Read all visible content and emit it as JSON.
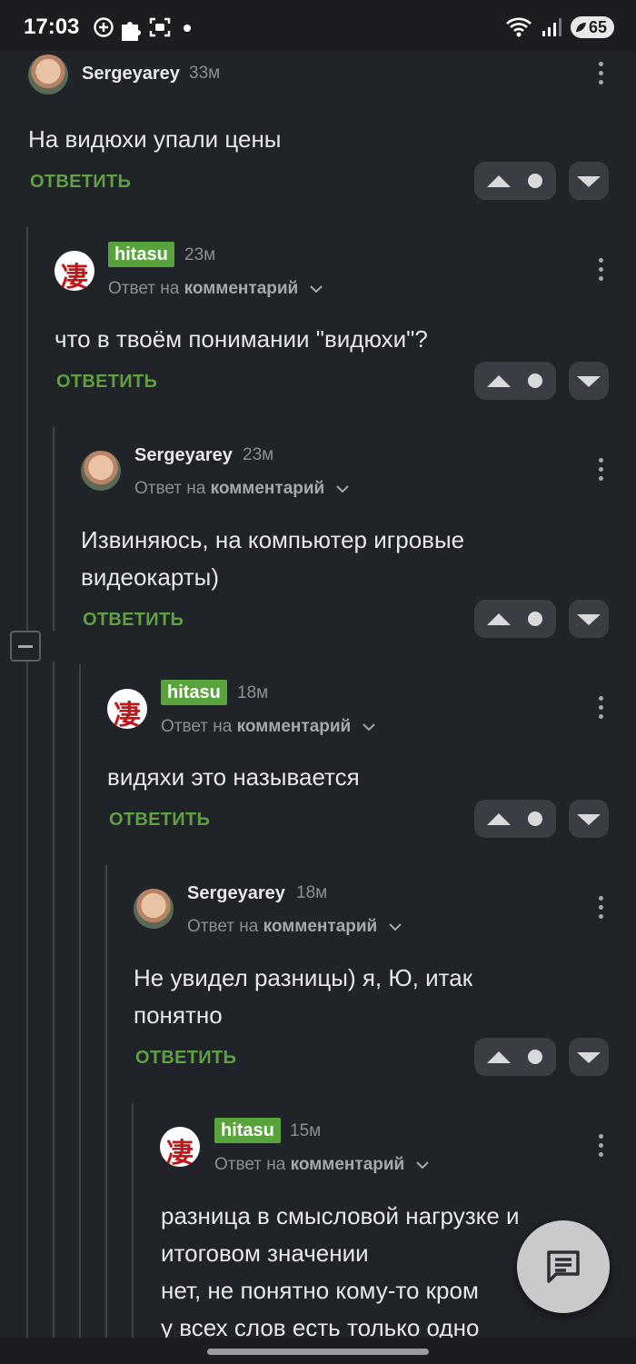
{
  "status_bar": {
    "time": "17:03",
    "battery": "65",
    "icons": [
      "add-circle-icon",
      "puzzle-icon",
      "scan-icon",
      "dot-icon",
      "wifi-icon",
      "signal-icon",
      "battery-icon"
    ]
  },
  "labels": {
    "reply_to_prefix": "Ответ на",
    "reply_to_target": "комментарий",
    "answer_button": "ОТВЕТИТЬ"
  },
  "comments": [
    {
      "author": "Sergeyarey",
      "time": "33м",
      "text_lines": [
        "На видюхи упали цены"
      ]
    },
    {
      "author": "hitasu",
      "time": "23м",
      "text_lines": [
        "что в твоём понимании \"видюхи\"?"
      ]
    },
    {
      "author": "Sergeyarey",
      "time": "23м",
      "text_lines": [
        "Извиняюсь, на компьютер игровые",
        "видеокарты)"
      ]
    },
    {
      "author": "hitasu",
      "time": "18м",
      "text_lines": [
        "видяхи это называется"
      ]
    },
    {
      "author": "Sergeyarey",
      "time": "18м",
      "text_lines": [
        "Не увидел разницы) я, Ю, итак",
        "понятно"
      ]
    },
    {
      "author": "hitasu",
      "time": "15м",
      "text_lines": [
        "разница в смысловой нагрузке и",
        "итоговом значении",
        "нет, не понятно кому-то кром",
        "у всех слов есть только одно"
      ]
    }
  ],
  "colors": {
    "background": "#202327",
    "accent_green": "#5fa043",
    "badge_green": "#58a33b"
  }
}
